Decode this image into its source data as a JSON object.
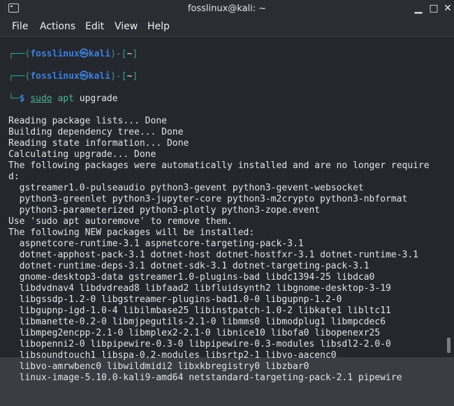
{
  "window": {
    "title": "fosslinux@kali: ~",
    "minimize": "▁",
    "maximize": "□",
    "close": "✕"
  },
  "menu": [
    "File",
    "Actions",
    "Edit",
    "View",
    "Help"
  ],
  "prompt": {
    "user": "fosslinux",
    "host": "kali",
    "dir": "~",
    "symbol": "㉿"
  },
  "command": {
    "sudo": "sudo",
    "apt": "apt",
    "arg": "upgrade"
  },
  "output": [
    "Reading package lists... Done",
    "Building dependency tree... Done",
    "Reading state information... Done",
    "Calculating upgrade... Done",
    "The following packages were automatically installed and are no longer require",
    "d:",
    "  gstreamer1.0-pulseaudio python3-gevent python3-gevent-websocket",
    "  python3-greenlet python3-jupyter-core python3-m2crypto python3-nbformat",
    "  python3-parameterized python3-plotly python3-zope.event",
    "Use 'sudo apt autoremove' to remove them.",
    "The following NEW packages will be installed:",
    "  aspnetcore-runtime-3.1 aspnetcore-targeting-pack-3.1",
    "  dotnet-apphost-pack-3.1 dotnet-host dotnet-hostfxr-3.1 dotnet-runtime-3.1",
    "  dotnet-runtime-deps-3.1 dotnet-sdk-3.1 dotnet-targeting-pack-3.1",
    "  gnome-desktop3-data gstreamer1.0-plugins-bad libdc1394-25 libdca0",
    "  libdvdnav4 libdvdread8 libfaad2 libfluidsynth2 libgnome-desktop-3-19",
    "  libgssdp-1.2-0 libgstreamer-plugins-bad1.0-0 libgupnp-1.2-0",
    "  libgupnp-igd-1.0-4 libilmbase25 libinstpatch-1.0-2 libkate1 libltc11",
    "  libmanette-0.2-0 libmjpegutils-2.1-0 libmms0 libmodplug1 libmpcdec6",
    "  libmpeg2encpp-2.1-0 libmplex2-2.1-0 libnice10 libofa0 libopenexr25",
    "  libopenni2-0 libpipewire-0.3-0 libpipewire-0.3-modules libsdl2-2.0-0",
    "  libsoundtouch1 libspa-0.2-modules libsrtp2-1 libvo-aacenc0",
    "  libvo-amrwbenc0 libwildmidi2 libxkbregistry0 libzbar0",
    "  linux-image-5.10.0-kali9-amd64 netstandard-targeting-pack-2.1 pipewire"
  ]
}
